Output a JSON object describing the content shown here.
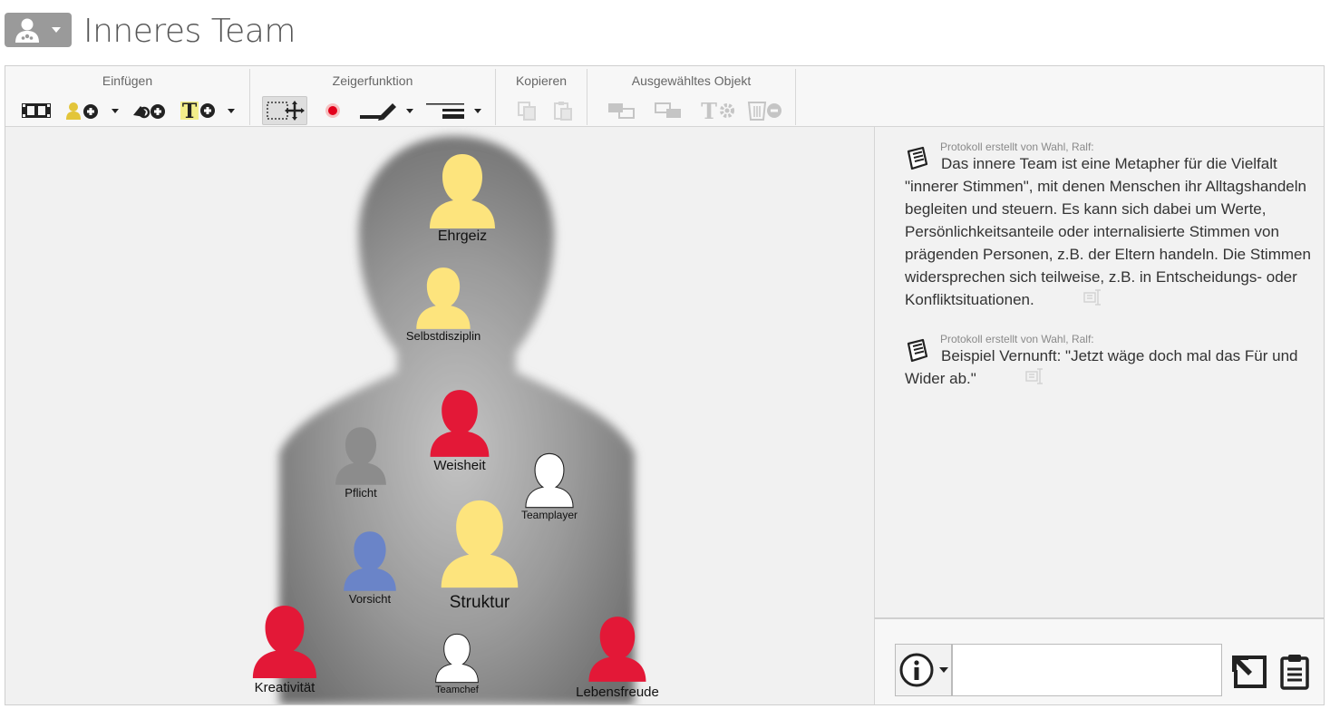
{
  "header": {
    "title": "Inneres Team",
    "app_icon": "user-group-icon"
  },
  "toolbar": {
    "groups": [
      {
        "label": "Einfügen"
      },
      {
        "label": "Zeigerfunktion"
      },
      {
        "label": "Kopieren"
      },
      {
        "label": "Ausgewähltes Objekt"
      }
    ]
  },
  "canvas": {
    "figures": [
      {
        "label": "Ehrgeiz",
        "color": "#fde47d"
      },
      {
        "label": "Selbstdisziplin",
        "color": "#fde47d"
      },
      {
        "label": "Weisheit",
        "color": "#e31837"
      },
      {
        "label": "Pflicht",
        "color": "#8c8c8c"
      },
      {
        "label": "Teamplayer",
        "color": "#ffffff"
      },
      {
        "label": "Vorsicht",
        "color": "#6a84c8"
      },
      {
        "label": "Struktur",
        "color": "#fde47d"
      },
      {
        "label": "Kreativität",
        "color": "#e31837"
      },
      {
        "label": "Teamchef",
        "color": "#ffffff"
      },
      {
        "label": "Lebensfreude",
        "color": "#e31837"
      }
    ]
  },
  "notes": [
    {
      "meta": "Protokoll erstellt von Wahl, Ralf:",
      "text": "Das innere Team ist eine Metapher für die Vielfalt \"innerer Stimmen\", mit denen Menschen ihr Alltagshandeln begleiten und steuern. Es kann sich dabei um Werte, Persönlichkeitsanteile oder internalisierte Stimmen von prägenden Personen, z.B. der Eltern handeln. Die Stimmen widersprechen sich teilweise, z.B. in Entscheidungs- oder Konfliktsituationen."
    },
    {
      "meta": "Protokoll erstellt von Wahl, Ralf:",
      "text": "Beispiel Vernunft: \"Jetzt wäge doch mal das Für und Wider ab.\""
    }
  ],
  "composer": {
    "value": "",
    "type_icon": "info-icon"
  },
  "colors": {
    "silhouette": "#7d7d7d",
    "yellow": "#fde47d",
    "red": "#e31837",
    "blue": "#6a84c8"
  }
}
